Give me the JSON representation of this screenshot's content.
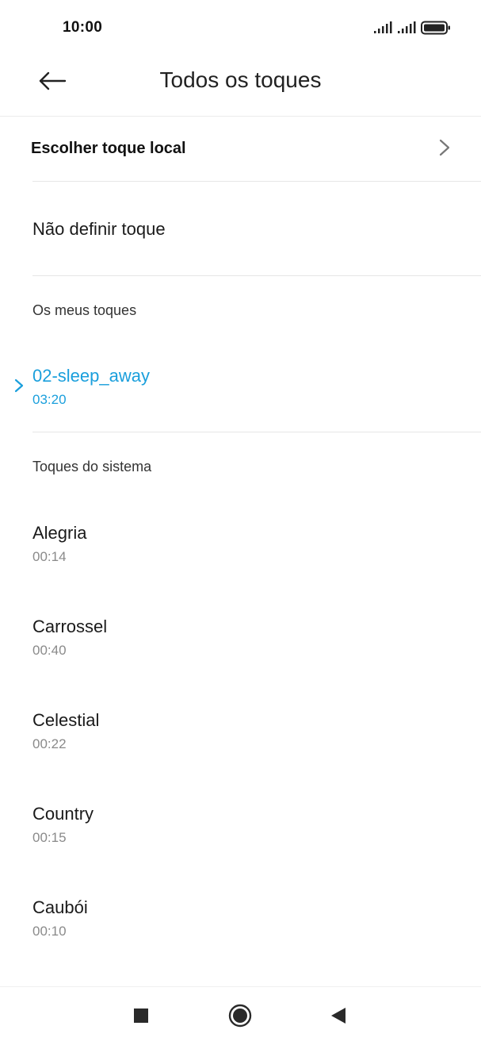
{
  "status_bar": {
    "time": "10:00",
    "icons": [
      "signal-icon",
      "signal-icon",
      "battery-icon"
    ]
  },
  "header": {
    "title": "Todos os toques",
    "back_icon": "arrow-left-icon"
  },
  "local_row": {
    "label": "Escolher toque local",
    "icon": "chevron-right-icon"
  },
  "none_row": {
    "label": "Não definir toque"
  },
  "my_tones": {
    "header": "Os meus toques",
    "items": [
      {
        "name": "02-sleep_away",
        "duration": "03:20",
        "selected": true
      }
    ]
  },
  "system_tones": {
    "header": "Toques do sistema",
    "items": [
      {
        "name": "Alegria",
        "duration": "00:14"
      },
      {
        "name": "Carrossel",
        "duration": "00:40"
      },
      {
        "name": "Celestial",
        "duration": "00:22"
      },
      {
        "name": "Country",
        "duration": "00:15"
      },
      {
        "name": "Caubói",
        "duration": "00:10"
      }
    ]
  },
  "navbar": {
    "icons": [
      "recents-square-icon",
      "home-circle-icon",
      "back-triangle-icon"
    ]
  },
  "colors": {
    "accent": "#1a9fdc",
    "secondary_text": "#8a8a8a",
    "divider": "#e6e6e6"
  }
}
